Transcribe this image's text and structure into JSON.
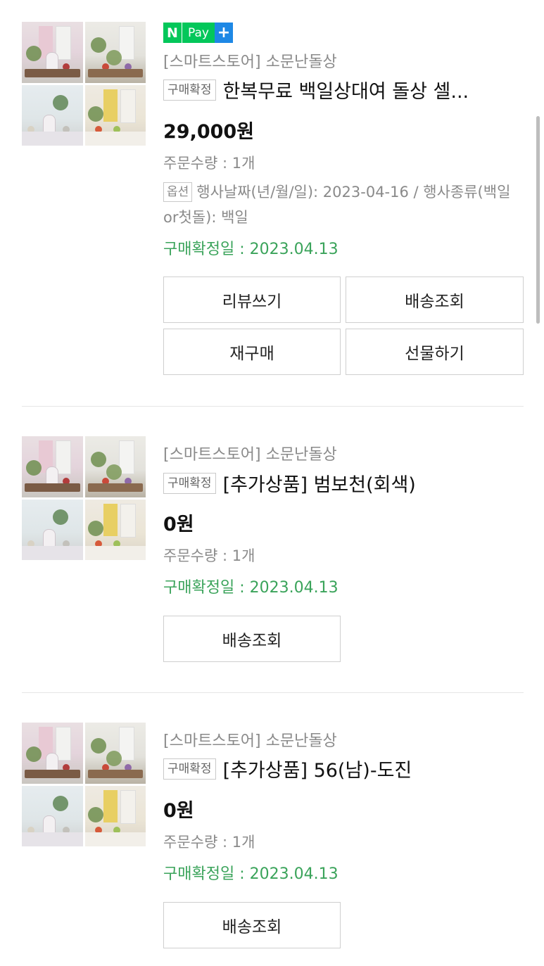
{
  "orders": [
    {
      "has_npay": true,
      "npay": {
        "n": "N",
        "pay": "Pay",
        "plus": "+"
      },
      "store": "[스마트스토어] 소문난돌상",
      "badge": "구매확정",
      "title": "한복무료 백일상대여 돌상 셀...",
      "price": "29,000원",
      "quantity": "주문수량 : 1개",
      "option_badge": "옵션",
      "option_text": "행사날짜(년/월/일): 2023-04-16 / 행사종류(백일or첫돌): 백일",
      "confirm_date": "구매확정일 : 2023.04.13",
      "buttons": [
        "리뷰쓰기",
        "배송조회",
        "재구매",
        "선물하기"
      ]
    },
    {
      "store": "[스마트스토어] 소문난돌상",
      "badge": "구매확정",
      "title": "[추가상품] 범보천(회색)",
      "price": "0원",
      "quantity": "주문수량 : 1개",
      "confirm_date": "구매확정일 : 2023.04.13",
      "buttons": [
        "배송조회"
      ]
    },
    {
      "store": "[스마트스토어] 소문난돌상",
      "badge": "구매확정",
      "title": "[추가상품] 56(남)-도진",
      "price": "0원",
      "quantity": "주문수량 : 1개",
      "confirm_date": "구매확정일 : 2023.04.13",
      "buttons": [
        "배송조회"
      ]
    }
  ],
  "colors": {
    "confirm_green": "#3aa35a",
    "npay_green": "#03c75a",
    "npay_blue": "#1e88e5"
  },
  "icons": {
    "thumbnail": "product-photo-collage"
  }
}
